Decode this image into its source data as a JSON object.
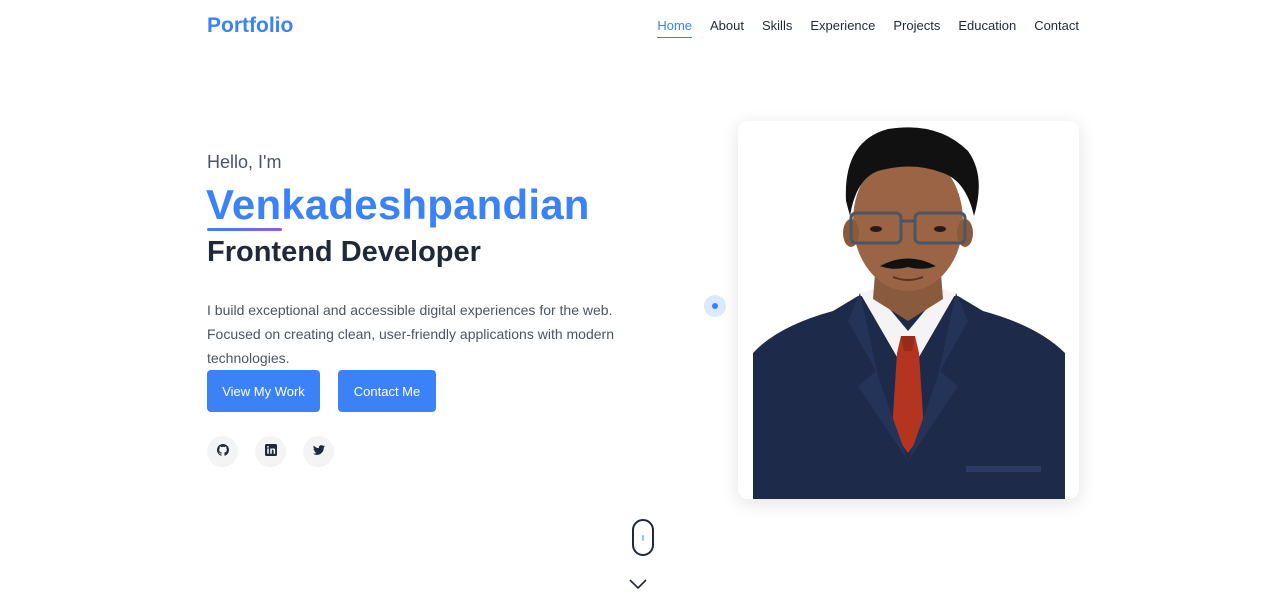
{
  "brand": {
    "title": "Portfolio"
  },
  "nav": {
    "items": [
      {
        "label": "Home",
        "active": true
      },
      {
        "label": "About"
      },
      {
        "label": "Skills"
      },
      {
        "label": "Experience"
      },
      {
        "label": "Projects"
      },
      {
        "label": "Education"
      },
      {
        "label": "Contact"
      }
    ]
  },
  "hero": {
    "greeting": "Hello, I'm",
    "name": "Venkadeshpandian",
    "role": "Frontend Developer",
    "bio": "I build exceptional and accessible digital experiences for the web. Focused on creating clean, user-friendly applications with modern technologies.",
    "buttons": {
      "primary": "View My Work",
      "secondary": "Contact Me"
    },
    "social": [
      {
        "icon": "github-icon"
      },
      {
        "icon": "linkedin-icon"
      },
      {
        "icon": "twitter-icon"
      }
    ]
  },
  "colors": {
    "accent": "#3b82f6",
    "accent_gradient_end": "#8b5cf6",
    "text_dark": "#1f2937",
    "text_muted": "#4b5563"
  },
  "icons": {
    "scroll": "mouse-scroll-icon",
    "chevron": "chevron-down-icon",
    "photo": "profile-photo"
  }
}
